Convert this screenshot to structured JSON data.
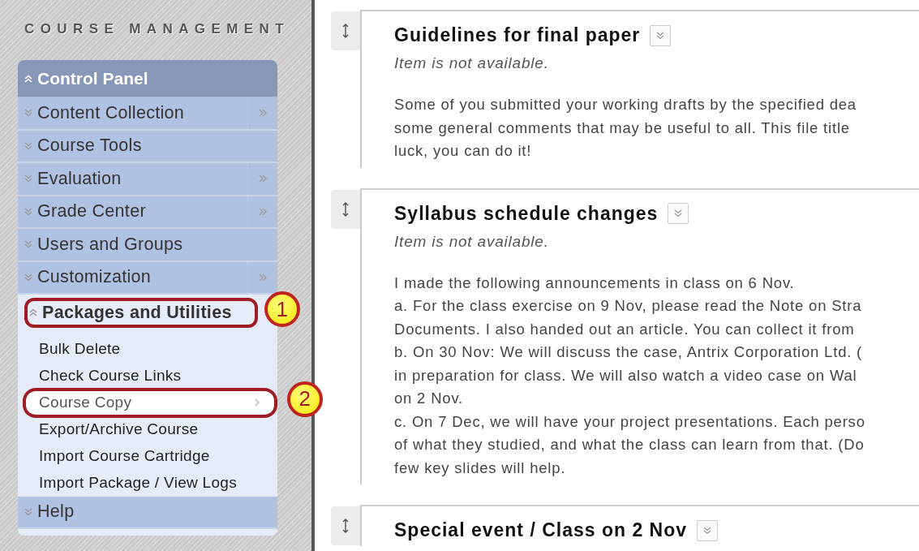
{
  "sidebar": {
    "heading": "COURSE MANAGEMENT",
    "panel": {
      "title": "Control Panel",
      "expanded": true,
      "items": [
        {
          "label": "Content Collection",
          "expanded": false,
          "submenu": true
        },
        {
          "label": "Course Tools",
          "expanded": false,
          "submenu": false
        },
        {
          "label": "Evaluation",
          "expanded": false,
          "submenu": true
        },
        {
          "label": "Grade Center",
          "expanded": false,
          "submenu": true
        },
        {
          "label": "Users and Groups",
          "expanded": false,
          "submenu": false
        },
        {
          "label": "Customization",
          "expanded": false,
          "submenu": true
        },
        {
          "label": "Packages and Utilities",
          "expanded": true,
          "submenu": false,
          "callout": "1",
          "children": [
            {
              "label": "Bulk Delete",
              "selected": false
            },
            {
              "label": "Check Course Links",
              "selected": false
            },
            {
              "label": "Course Copy",
              "selected": true,
              "callout": "2"
            },
            {
              "label": "Export/Archive Course",
              "selected": false
            },
            {
              "label": "Import Course Cartridge",
              "selected": false
            },
            {
              "label": "Import Package / View Logs",
              "selected": false
            }
          ]
        },
        {
          "label": "Help",
          "expanded": false,
          "submenu": false
        }
      ]
    }
  },
  "content": {
    "items": [
      {
        "title": "Guidelines for final paper",
        "status": "Item is not available.",
        "lines": [
          "Some of you submitted your working drafts by the specified dea",
          "some general comments that may be useful to all. This file title",
          "luck, you can do it!"
        ]
      },
      {
        "title": "Syllabus schedule changes",
        "status": "Item is not available.",
        "lines": [
          "I made the following announcements in class on 6 Nov.",
          "a. For the class exercise on 9 Nov, please read the Note on Stra",
          "Documents. I also handed out an article. You can collect it from",
          "b. On 30 Nov: We will discuss the case, Antrix Corporation Ltd. (",
          "in preparation for class. We will also watch a video case on Wal",
          "on 2 Nov.",
          "c. On 7 Dec, we will have your project presentations. Each perso",
          "of what they studied, and what the class can learn from that. (Do",
          "few key slides will help."
        ]
      },
      {
        "title": "Special event / Class on 2 Nov"
      }
    ]
  }
}
